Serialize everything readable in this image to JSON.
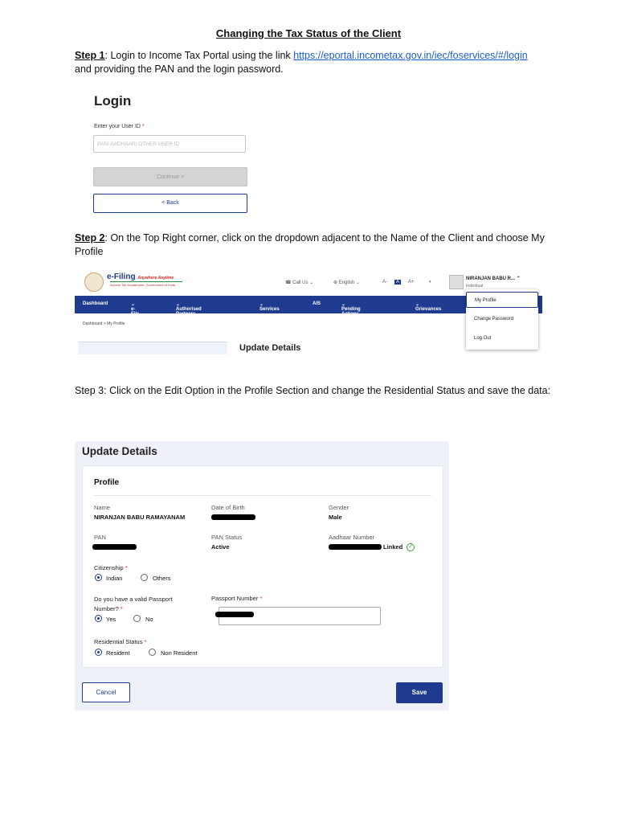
{
  "doc": {
    "title": "Changing the Tax Status of the Client",
    "step1_label": "Step 1",
    "step1_text": ": Login to Income Tax Portal using the link ",
    "step1_link": "https://eportal.incometax.gov.in/iec/foservices/#/login",
    "step1_text2": "and providing the PAN and the login password.",
    "step2_label": "Step 2",
    "step2_text": ": On the Top Right corner, click on the dropdown adjacent to the Name of the Client and choose My Profile",
    "step3_text": "Step 3: Click on the Edit Option in the Profile Section and change the Residential Status and save the data:"
  },
  "login": {
    "title": "Login",
    "user_id_label": "Enter your User ID",
    "required_mark": "*",
    "user_id_placeholder": "PAN/ AADHAAR/ OTHER USER ID",
    "continue_label": "Continue  >",
    "back_label": "<  Back"
  },
  "portal": {
    "logo_text": "e-Filing",
    "logo_tagline": "Anywhere Anytime",
    "logo_sub": "Income Tax Department, Government of India",
    "call_us": "Call Us",
    "language": "English",
    "font_small": "A-",
    "font_default": "A",
    "font_large": "A+",
    "contrast": "◐",
    "user_name": "NIRANJAN BABU R...",
    "user_type": "Individual",
    "nav": [
      "Dashboard",
      "e-File",
      "Authorised Partners",
      "Services",
      "AIS",
      "Pending Actions",
      "Grievances"
    ],
    "breadcrumb": "Dashboard  >  My Profile",
    "page_heading": "Update Details",
    "dropdown": [
      "My Profile",
      "Change Password",
      "Log Out"
    ]
  },
  "update": {
    "heading": "Update Details",
    "section": "Profile",
    "name_label": "Name",
    "name_value": "NIRANJAN BABU RAMAYANAM",
    "dob_label": "Date of Birth",
    "gender_label": "Gender",
    "gender_value": "Male",
    "pan_label": "PAN",
    "pan_status_label": "PAN Status",
    "pan_status_value": "Active",
    "aadhaar_label": "Aadhaar Number",
    "linked_label": "Linked",
    "citizenship_label": "Citizenship",
    "citizenship_options": [
      "Indian",
      "Others"
    ],
    "citizenship_selected": "Indian",
    "passport_q_label": "Do you have a valid Passport Number?",
    "passport_q_options": [
      "Yes",
      "No"
    ],
    "passport_q_selected": "Yes",
    "passport_number_label": "Passport Number",
    "residential_label": "Residential Status",
    "residential_options": [
      "Resident",
      "Non Resident"
    ],
    "residential_selected": "Resident",
    "cancel_label": "Cancel",
    "save_label": "Save",
    "required_mark": "*"
  },
  "colors": {
    "brand_blue": "#1e3b8f",
    "link_blue": "#1a5fd1",
    "required_red": "#d22"
  }
}
